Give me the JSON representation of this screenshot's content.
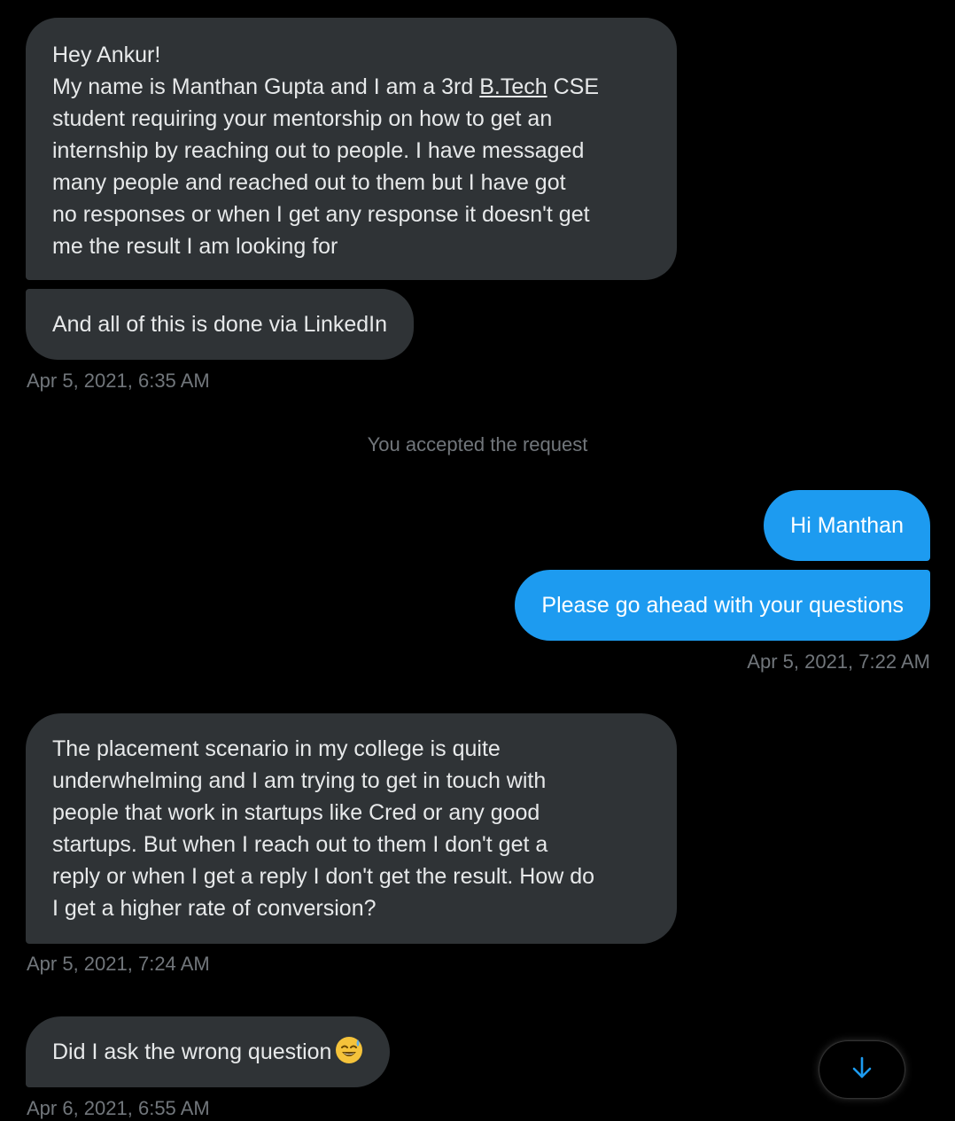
{
  "messages": [
    {
      "lines": [
        "Hey Ankur!",
        "My name is Manthan Gupta and I am a 3rd ",
        "student requiring your mentorship on how to get an",
        "internship by reaching out to people. I have messaged",
        "many people and reached out to them but I have got",
        "no responses or when I get any response it doesn't get",
        "me the result I am looking for"
      ],
      "link": "B.Tech",
      "after_link": " CSE"
    },
    {
      "text": "And all of this is done via LinkedIn"
    },
    {
      "text": "Hi Manthan"
    },
    {
      "text": "Please go ahead with your questions"
    },
    {
      "lines": [
        "The placement scenario in my college is quite",
        "underwhelming and I am trying to get in touch with",
        "people that work in startups like Cred or any good",
        "startups. But when I reach out to them I don't get a",
        "reply or when I get a reply I don't get the result. How do",
        "I get a higher rate of conversion?"
      ]
    },
    {
      "text": "Did I ask the wrong question",
      "emoji": "sweat-smile-emoji"
    }
  ],
  "timestamps": [
    "Apr 5, 2021, 6:35 AM",
    "Apr 5, 2021, 7:22 AM",
    "Apr 5, 2021, 7:24 AM",
    "Apr 6, 2021, 6:55 AM"
  ],
  "system": {
    "accepted": "You accepted the request"
  },
  "scroll_button": {
    "icon": "arrow-down-icon"
  },
  "colors": {
    "background": "#000000",
    "incoming_bubble": "#2f3336",
    "outgoing_bubble": "#1d9bf0",
    "muted_text": "#71767b",
    "accent": "#1d9bf0"
  }
}
